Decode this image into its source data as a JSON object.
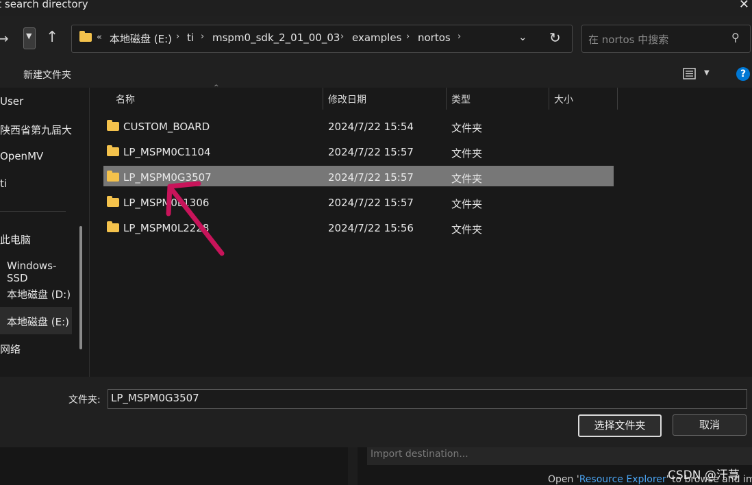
{
  "window": {
    "title": "ct search directory"
  },
  "address": {
    "crumbs": [
      "本地磁盘 (E:)",
      "ti",
      "mspm0_sdk_2_01_00_03",
      "examples",
      "nortos"
    ],
    "overflow_glyph": "«",
    "search_placeholder": "在 nortos 中搜索"
  },
  "toolbar": {
    "new_folder": "新建文件夹"
  },
  "sidebar": {
    "items": [
      "User",
      "陕西省第九届大",
      "OpenMV",
      "ti",
      "此电脑",
      "Windows-SSD",
      "本地磁盘 (D:)",
      "本地磁盘 (E:)",
      "网络"
    ],
    "selected_index": 7
  },
  "columns": {
    "name": "名称",
    "date": "修改日期",
    "type": "类型",
    "size": "大小"
  },
  "files": [
    {
      "name": "CUSTOM_BOARD",
      "date": "2024/7/22 15:54",
      "type": "文件夹",
      "selected": false
    },
    {
      "name": "LP_MSPM0C1104",
      "date": "2024/7/22 15:57",
      "type": "文件夹",
      "selected": false
    },
    {
      "name": "LP_MSPM0G3507",
      "date": "2024/7/22 15:57",
      "type": "文件夹",
      "selected": true
    },
    {
      "name": "LP_MSPM0L1306",
      "date": "2024/7/22 15:57",
      "type": "文件夹",
      "selected": false
    },
    {
      "name": "LP_MSPM0L2228",
      "date": "2024/7/22 15:56",
      "type": "文件夹",
      "selected": false
    }
  ],
  "bottom": {
    "folder_label": "文件夹:",
    "folder_value": "LP_MSPM0G3507",
    "select_button": "选择文件夹",
    "cancel_button": "取消"
  },
  "background": {
    "import_placeholder": "Import destination...",
    "hint_prefix": "Open '",
    "hint_link": "Resource Explorer",
    "hint_suffix": "' to browse and impo"
  },
  "watermark": "CSDN @汗荨",
  "colors": {
    "accent": "#0078d4",
    "folder": "#f4c24c",
    "annotation_arrow": "#c8145a",
    "selected_row": "#777777"
  }
}
